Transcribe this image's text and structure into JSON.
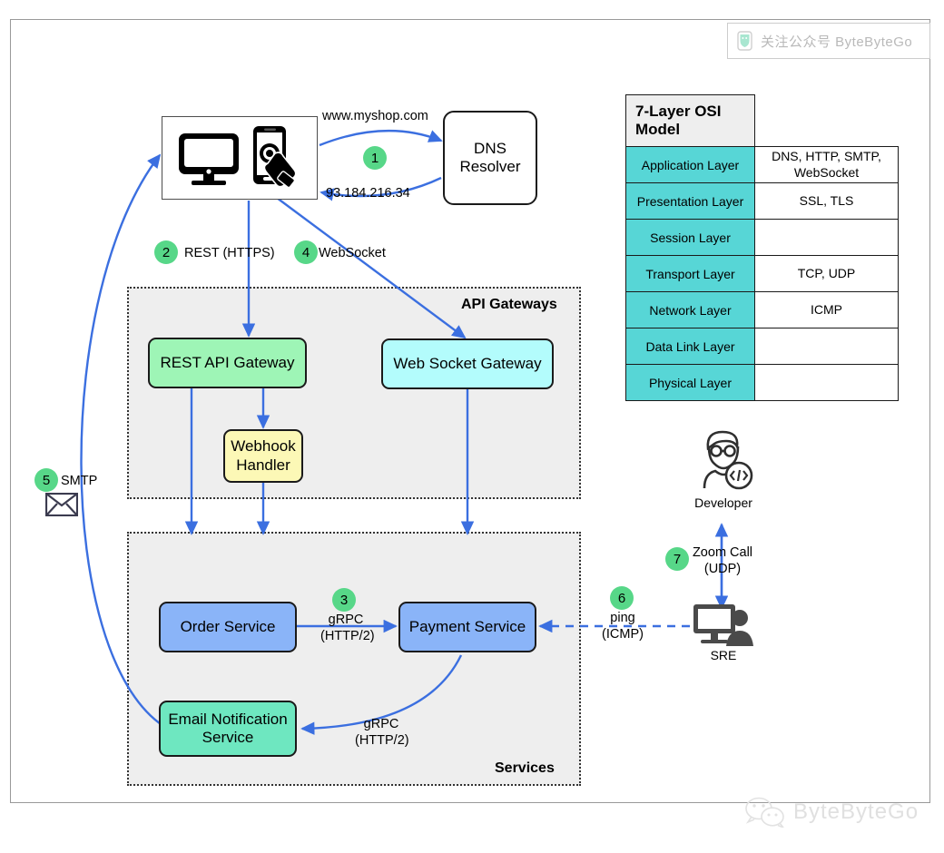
{
  "frame": {
    "present": true
  },
  "watermark": {
    "top_text": "关注公众号 ByteByteGo",
    "top_icon": "wechat-badge-icon",
    "bottom_text": "ByteByteGo",
    "bottom_icon": "wechat-icon"
  },
  "client": {
    "desktop_icon": "desktop-monitor-icon",
    "mobile_icon": "smartphone-tap-icon"
  },
  "dns": {
    "line1": "DNS",
    "line2": "Resolver"
  },
  "flows": {
    "dns_request": "www.myshop.com",
    "dns_response": "93.184.216.34",
    "rest": "REST (HTTPS)",
    "websocket": "WebSocket",
    "smtp": "SMTP",
    "grpc_line1": "gRPC",
    "grpc_line2": "(HTTP/2)",
    "grpc2_line1": "gRPC",
    "grpc2_line2": "(HTTP/2)",
    "ping_line1": "ping",
    "ping_line2": "(ICMP)",
    "zoom_line1": "Zoom Call",
    "zoom_line2": "(UDP)"
  },
  "badges": {
    "b1": "1",
    "b2": "2",
    "b3": "3",
    "b4": "4",
    "b5": "5",
    "b6": "6",
    "b7": "7"
  },
  "groups": {
    "gateways_label": "API Gateways",
    "services_label": "Services"
  },
  "nodes": {
    "rest_gateway": {
      "label": "REST API Gateway",
      "color": "#9ef5b6"
    },
    "ws_gateway": {
      "label": "Web Socket Gateway",
      "color": "#b3fcfc"
    },
    "webhook_line1": "Webhook",
    "webhook_line2": "Handler",
    "webhook_color": "#fcf8b6",
    "order_service": {
      "label": "Order Service",
      "color": "#8ab4f8"
    },
    "payment_service": {
      "label": "Payment Service",
      "color": "#8ab4f8"
    },
    "email_service_line1": "Email Notification",
    "email_service_line2": "Service",
    "email_color": "#6ee7c0"
  },
  "people": {
    "developer": "Developer",
    "sre": "SRE",
    "developer_icon": "developer-person-code-icon",
    "sre_icon": "sre-person-monitor-icon",
    "envelope_icon": "envelope-icon"
  },
  "osi": {
    "title": "7-Layer OSI Model",
    "rows": [
      {
        "layer": "Application Layer",
        "protocols": "DNS, HTTP, SMTP, WebSocket"
      },
      {
        "layer": "Presentation Layer",
        "protocols": "SSL, TLS"
      },
      {
        "layer": "Session Layer",
        "protocols": ""
      },
      {
        "layer": "Transport Layer",
        "protocols": "TCP, UDP"
      },
      {
        "layer": "Network Layer",
        "protocols": "ICMP"
      },
      {
        "layer": "Data Link Layer",
        "protocols": ""
      },
      {
        "layer": "Physical Layer",
        "protocols": ""
      }
    ],
    "header_bg": "#eeeeee",
    "layer_bg": "#57d6d6"
  },
  "colors": {
    "arrow": "#3b6fe0",
    "badge": "#57d788",
    "group_bg": "#eeeeee"
  }
}
